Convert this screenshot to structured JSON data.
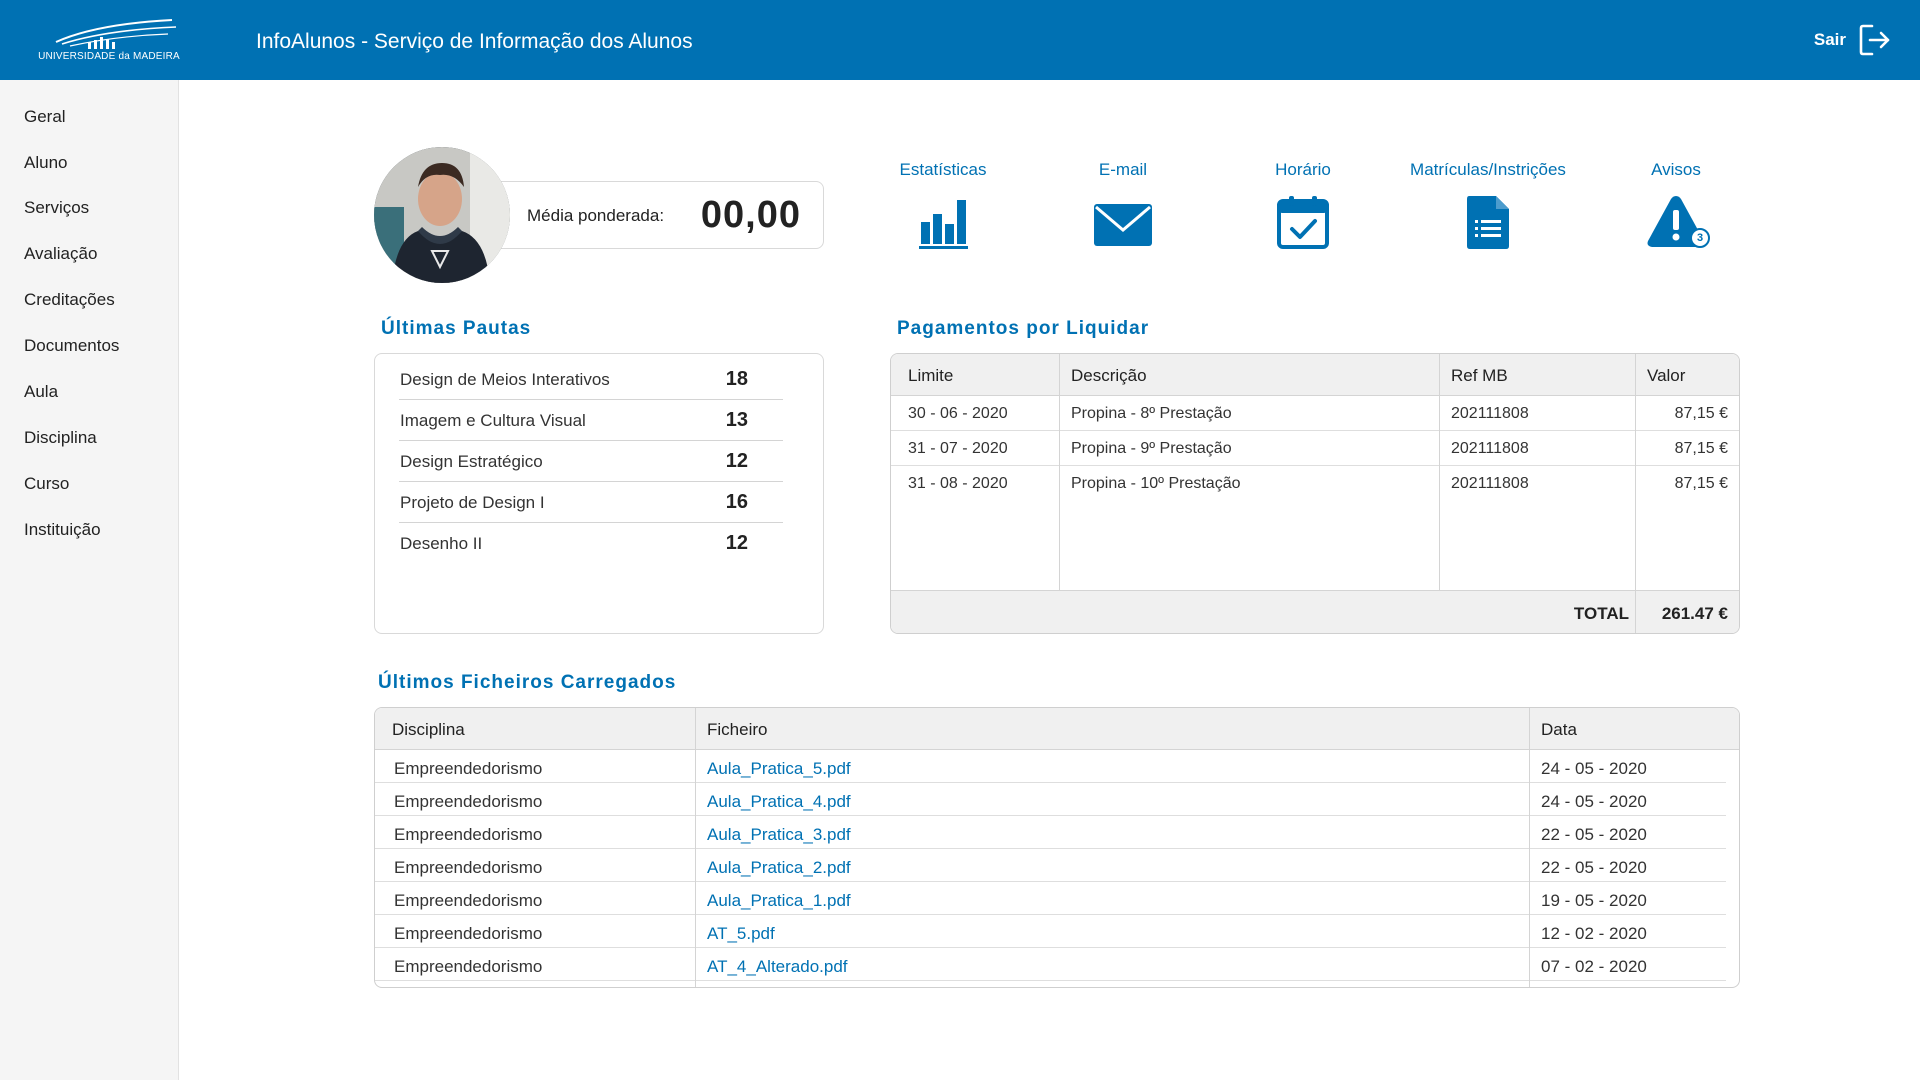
{
  "header": {
    "logo_text": "UNIVERSIDADE da MADEIRA",
    "title": "InfoAlunos -  Serviço de Informação dos Alunos",
    "logout_label": "Sair",
    "background": "#0071b3"
  },
  "sidebar": {
    "items": [
      {
        "label": "Geral"
      },
      {
        "label": "Aluno"
      },
      {
        "label": "Serviços"
      },
      {
        "label": "Avaliação"
      },
      {
        "label": "Creditações"
      },
      {
        "label": "Documentos"
      },
      {
        "label": "Aula"
      },
      {
        "label": "Disciplina"
      },
      {
        "label": "Curso"
      },
      {
        "label": "Instituição"
      }
    ]
  },
  "profile": {
    "media_label": "Média ponderada:",
    "media_value": "00,00"
  },
  "quick_links": [
    {
      "label": "Estatísticas",
      "icon": "bar-chart-icon"
    },
    {
      "label": "E-mail",
      "icon": "envelope-icon"
    },
    {
      "label": "Horário",
      "icon": "calendar-check-icon"
    },
    {
      "label": "Matrículas/Instrições",
      "icon": "document-list-icon"
    },
    {
      "label": "Avisos",
      "icon": "warning-icon",
      "badge": "3"
    }
  ],
  "pautas": {
    "title": "Últimas Pautas",
    "rows": [
      {
        "disciplina": "Design de Meios Interativos",
        "nota": "18"
      },
      {
        "disciplina": "Imagem e Cultura Visual",
        "nota": "13"
      },
      {
        "disciplina": "Design Estratégico",
        "nota": "12"
      },
      {
        "disciplina": "Projeto de Design I",
        "nota": "16"
      },
      {
        "disciplina": "Desenho II",
        "nota": "12"
      }
    ]
  },
  "pagamentos": {
    "title": "Pagamentos por Liquidar",
    "columns": [
      "Limite",
      "Descrição",
      "Ref MB",
      "Valor"
    ],
    "rows": [
      {
        "limite": "30 - 06 - 2020",
        "descricao": "Propina - 8º Prestação",
        "ref": "202111808",
        "valor": "87,15 €"
      },
      {
        "limite": "31 - 07 - 2020",
        "descricao": "Propina - 9º Prestação",
        "ref": "202111808",
        "valor": "87,15 €"
      },
      {
        "limite": "31 - 08 - 2020",
        "descricao": "Propina - 10º Prestação",
        "ref": "202111808",
        "valor": "87,15 €"
      }
    ],
    "total_label": "TOTAL",
    "total_value": "261.47 €"
  },
  "ficheiros": {
    "title": "Últimos Ficheiros Carregados",
    "columns": [
      "Disciplina",
      "Ficheiro",
      "Data"
    ],
    "rows": [
      {
        "disciplina": "Empreendedorismo",
        "ficheiro": "Aula_Pratica_5.pdf",
        "data": "24 - 05 - 2020"
      },
      {
        "disciplina": "Empreendedorismo",
        "ficheiro": "Aula_Pratica_4.pdf",
        "data": "24 - 05 - 2020"
      },
      {
        "disciplina": "Empreendedorismo",
        "ficheiro": "Aula_Pratica_3.pdf",
        "data": "22 - 05 - 2020"
      },
      {
        "disciplina": "Empreendedorismo",
        "ficheiro": "Aula_Pratica_2.pdf",
        "data": "22 - 05 - 2020"
      },
      {
        "disciplina": "Empreendedorismo",
        "ficheiro": "Aula_Pratica_1.pdf",
        "data": "19 - 05 - 2020"
      },
      {
        "disciplina": "Empreendedorismo",
        "ficheiro": "AT_5.pdf",
        "data": "12 - 02 - 2020"
      },
      {
        "disciplina": "Empreendedorismo",
        "ficheiro": "AT_4_Alterado.pdf",
        "data": "07 - 02 - 2020"
      }
    ]
  }
}
